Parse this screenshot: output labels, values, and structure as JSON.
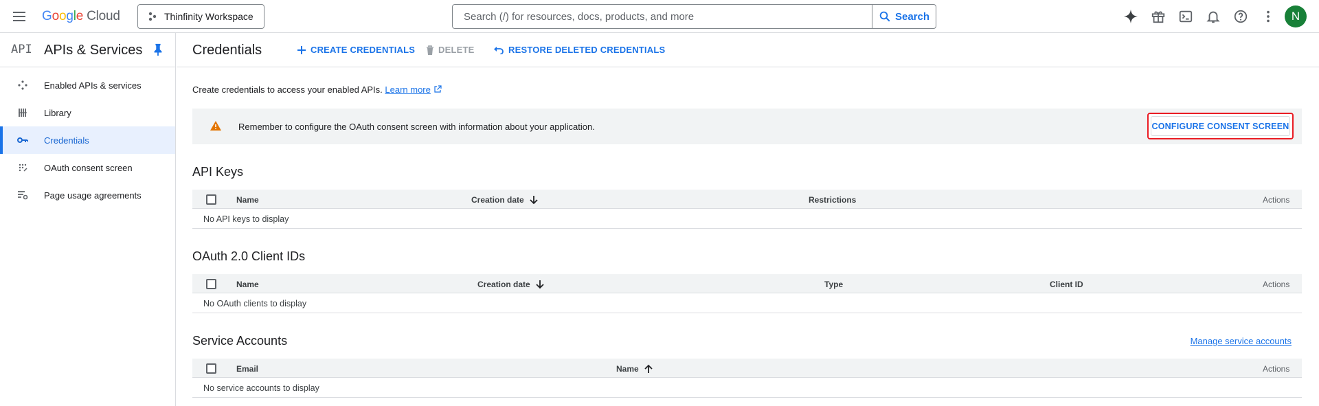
{
  "topbar": {
    "logo_letters": [
      "G",
      "o",
      "o",
      "g",
      "l",
      "e"
    ],
    "logo_cloud": "Cloud",
    "project_name": "Thinfinity Workspace",
    "search_placeholder": "Search (/) for resources, docs, products, and more",
    "search_button": "Search",
    "avatar_initial": "N",
    "icons": [
      "gemini-spark-icon",
      "gift-icon",
      "terminal-icon",
      "bell-icon",
      "help-icon",
      "more-vert-icon"
    ]
  },
  "sidebar": {
    "logo": "API",
    "title": "APIs & Services",
    "items": [
      {
        "label": "Enabled APIs & services",
        "icon": "enabled-apis-icon",
        "active": false
      },
      {
        "label": "Library",
        "icon": "library-icon",
        "active": false
      },
      {
        "label": "Credentials",
        "icon": "key-icon",
        "active": true
      },
      {
        "label": "OAuth consent screen",
        "icon": "oauth-icon",
        "active": false
      },
      {
        "label": "Page usage agreements",
        "icon": "settings-list-icon",
        "active": false
      }
    ]
  },
  "header": {
    "title": "Credentials",
    "create_label": "CREATE CREDENTIALS",
    "delete_label": "DELETE",
    "restore_label": "RESTORE DELETED CREDENTIALS"
  },
  "main": {
    "intro_text": "Create credentials to access your enabled APIs.",
    "learn_more": "Learn more",
    "banner_text": "Remember to configure the OAuth consent screen with information about your application.",
    "config_button": "CONFIGURE CONSENT SCREEN",
    "api_keys": {
      "title": "API Keys",
      "columns": [
        "Name",
        "Creation date",
        "Restrictions",
        "Actions"
      ],
      "empty": "No API keys to display"
    },
    "oauth": {
      "title": "OAuth 2.0 Client IDs",
      "columns": [
        "Name",
        "Creation date",
        "Type",
        "Client ID",
        "Actions"
      ],
      "empty": "No OAuth clients to display"
    },
    "service_accounts": {
      "title": "Service Accounts",
      "manage_link": "Manage service accounts",
      "columns": [
        "Email",
        "Name",
        "Actions"
      ],
      "empty": "No service accounts to display"
    }
  },
  "colors": {
    "accent": "#1a73e8",
    "highlight_border": "#ea1c24",
    "warning": "#e37400",
    "avatar_bg": "#188038"
  }
}
